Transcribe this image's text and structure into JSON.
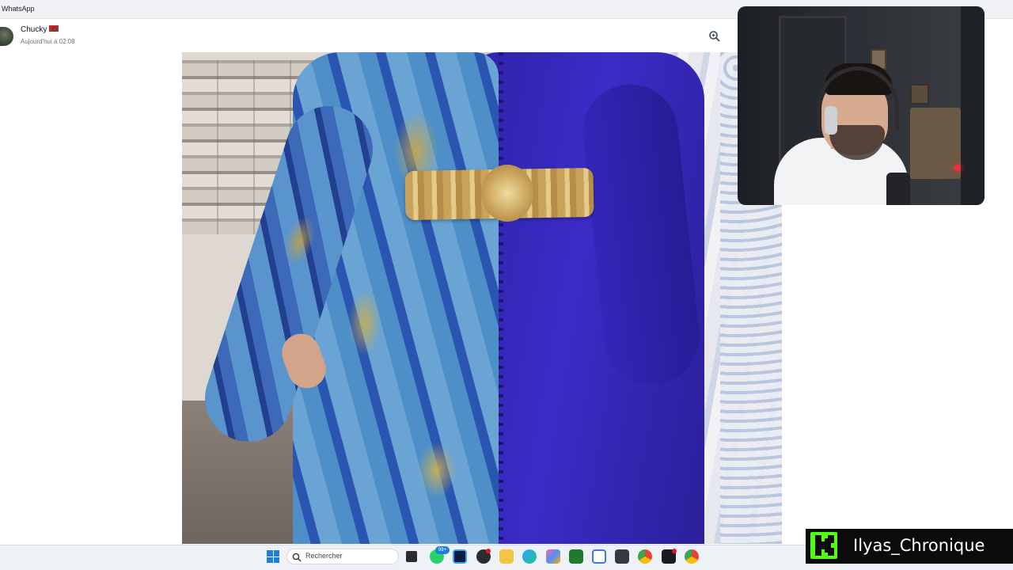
{
  "app": {
    "title": "WhatsApp"
  },
  "chat": {
    "contact_name": "Chucky",
    "timestamp": "Aujourd'hui à 02:08"
  },
  "viewer": {
    "actions": [
      "zoom-in-icon"
    ]
  },
  "webcam": {
    "description_icon": "webcam-overlay"
  },
  "taskbar": {
    "search_placeholder": "Rechercher",
    "whatsapp_badge": "99+",
    "icons": [
      "start-icon",
      "search-icon",
      "task-view-icon",
      "whatsapp-icon",
      "photoshop-icon",
      "app-icon",
      "file-explorer-icon",
      "edge-icon",
      "copilot-icon",
      "app-icon",
      "snipping-tool-icon",
      "app-icon",
      "chrome-icon",
      "app-icon",
      "chrome-icon"
    ]
  },
  "overlay": {
    "streamer_name": "Ilyas_Chronique",
    "platform_icon": "kick-icon",
    "accent": "#53fc18"
  },
  "colors": {
    "titlebar": "#f0f2f5",
    "taskbar": "#eef1f6",
    "start_blue": "#1e7fd9"
  }
}
